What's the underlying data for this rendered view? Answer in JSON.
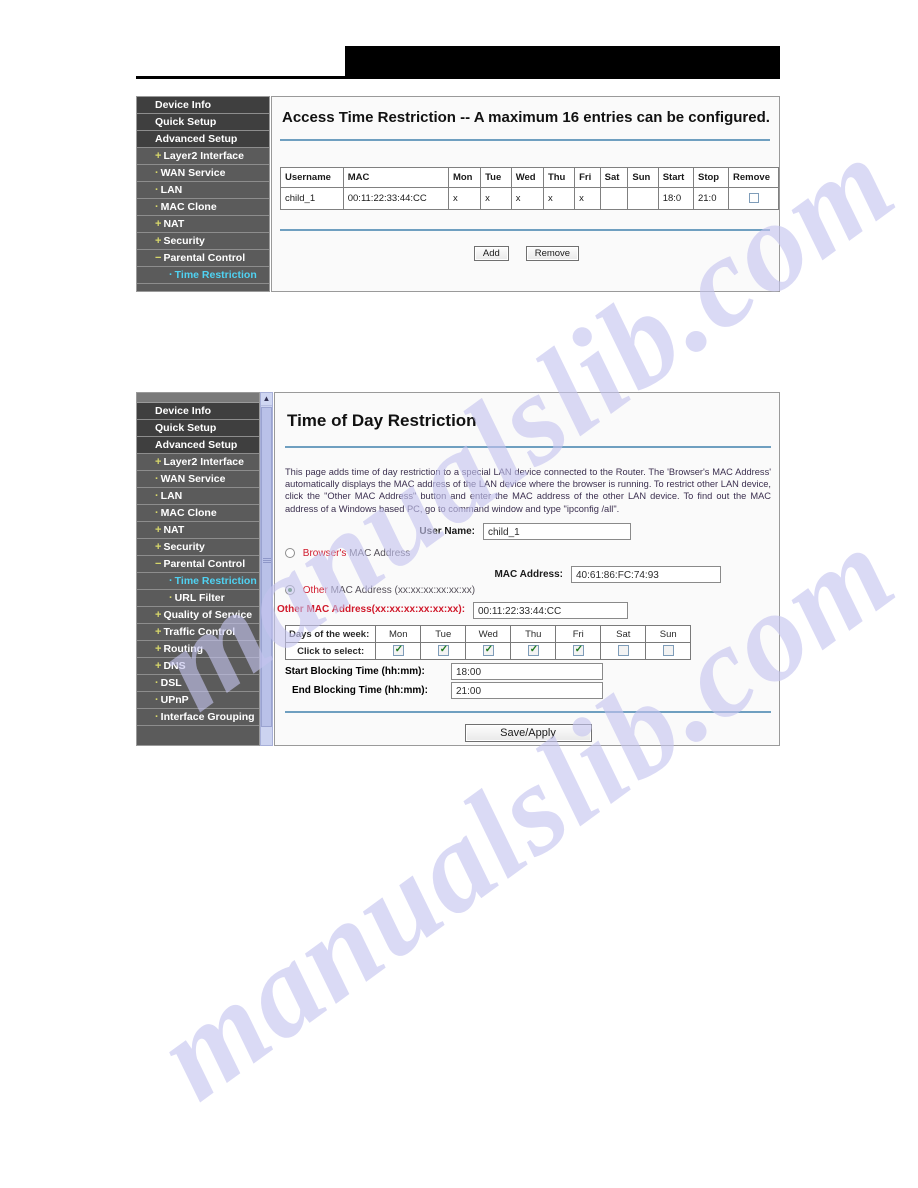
{
  "watermark": {
    "text": "manualslib.com"
  },
  "panel1": {
    "sidebar": [
      {
        "label": "Device Info",
        "level": 0,
        "bullet": "",
        "active": false
      },
      {
        "label": "Quick Setup",
        "level": 0,
        "bullet": "",
        "active": false
      },
      {
        "label": "Advanced Setup",
        "level": 0,
        "bullet": "",
        "active": false
      },
      {
        "label": "Layer2 Interface",
        "level": 1,
        "bullet": "+",
        "active": false
      },
      {
        "label": "WAN Service",
        "level": 1,
        "bullet": "·",
        "active": false
      },
      {
        "label": "LAN",
        "level": 1,
        "bullet": "·",
        "active": false
      },
      {
        "label": "MAC Clone",
        "level": 1,
        "bullet": "·",
        "active": false
      },
      {
        "label": "NAT",
        "level": 1,
        "bullet": "+",
        "active": false
      },
      {
        "label": "Security",
        "level": 1,
        "bullet": "+",
        "active": false
      },
      {
        "label": "Parental Control",
        "level": 1,
        "bullet": "−",
        "active": false
      },
      {
        "label": "Time Restriction",
        "level": 2,
        "bullet": "·",
        "active": true
      }
    ],
    "title": "Access Time Restriction -- A maximum 16 entries can be configured.",
    "table": {
      "headers": [
        "Username",
        "MAC",
        "Mon",
        "Tue",
        "Wed",
        "Thu",
        "Fri",
        "Sat",
        "Sun",
        "Start",
        "Stop",
        "Remove"
      ],
      "rows": [
        {
          "username": "child_1",
          "mac": "00:11:22:33:44:CC",
          "mon": "x",
          "tue": "x",
          "wed": "x",
          "thu": "x",
          "fri": "x",
          "sat": "",
          "sun": "",
          "start": "18:0",
          "stop": "21:0",
          "remove_checked": false
        }
      ]
    },
    "buttons": {
      "add": "Add",
      "remove": "Remove"
    }
  },
  "panel2": {
    "sidebar": [
      {
        "label": "Device Info",
        "level": 0,
        "bullet": "",
        "active": false
      },
      {
        "label": "Quick Setup",
        "level": 0,
        "bullet": "",
        "active": false
      },
      {
        "label": "Advanced Setup",
        "level": 0,
        "bullet": "",
        "active": false
      },
      {
        "label": "Layer2 Interface",
        "level": 1,
        "bullet": "+",
        "active": false
      },
      {
        "label": "WAN Service",
        "level": 1,
        "bullet": "·",
        "active": false
      },
      {
        "label": "LAN",
        "level": 1,
        "bullet": "·",
        "active": false
      },
      {
        "label": "MAC Clone",
        "level": 1,
        "bullet": "·",
        "active": false
      },
      {
        "label": "NAT",
        "level": 1,
        "bullet": "+",
        "active": false
      },
      {
        "label": "Security",
        "level": 1,
        "bullet": "+",
        "active": false
      },
      {
        "label": "Parental Control",
        "level": 1,
        "bullet": "−",
        "active": false
      },
      {
        "label": "Time Restriction",
        "level": 2,
        "bullet": "·",
        "active": true
      },
      {
        "label": "URL Filter",
        "level": 2,
        "bullet": "·",
        "active": false
      },
      {
        "label": "Quality of Service",
        "level": 1,
        "bullet": "+",
        "active": false
      },
      {
        "label": "Traffic Control",
        "level": 1,
        "bullet": "+",
        "active": false
      },
      {
        "label": "Routing",
        "level": 1,
        "bullet": "+",
        "active": false
      },
      {
        "label": "DNS",
        "level": 1,
        "bullet": "+",
        "active": false
      },
      {
        "label": "DSL",
        "level": 1,
        "bullet": "·",
        "active": false
      },
      {
        "label": "UPnP",
        "level": 1,
        "bullet": "·",
        "active": false
      },
      {
        "label": "Interface Grouping",
        "level": 1,
        "bullet": "·",
        "active": false
      }
    ],
    "title": "Time of Day Restriction",
    "description": "This page adds time of day restriction to a special LAN device connected to the Router. The 'Browser's MAC Address' automatically displays the MAC address of the LAN device where the browser is running. To restrict other LAN device, click the \"Other MAC Address\" button and enter the MAC address of the other LAN device. To find out the MAC address of a Windows based PC, go to command window and type \"ipconfig /all\".",
    "form": {
      "user_name_label": "User Name:",
      "user_name_value": "child_1",
      "browsers_mac_label_red": "Browser's",
      "browsers_mac_label_rest": "MAC Address",
      "browsers_mac_selected": false,
      "mac_address_label": "MAC Address:",
      "mac_address_value": "40:61:86:FC:74:93",
      "other_mac_label_red": "Other",
      "other_mac_label_rest": "MAC Address (xx:xx:xx:xx:xx:xx)",
      "other_mac_selected": true,
      "other_mac_input_label": "Other MAC Address(xx:xx:xx:xx:xx:xx):",
      "other_mac_input_value": "00:11:22:33:44:CC",
      "days_row_label": "Days of the week:",
      "select_row_label": "Click to select:",
      "days": [
        "Mon",
        "Tue",
        "Wed",
        "Thu",
        "Fri",
        "Sat",
        "Sun"
      ],
      "days_checked": [
        true,
        true,
        true,
        true,
        true,
        false,
        false
      ],
      "start_label": "Start Blocking Time (hh:mm):",
      "start_value": "18:00",
      "end_label": "End Blocking Time (hh:mm):",
      "end_value": "21:00",
      "save_label": "Save/Apply"
    }
  }
}
